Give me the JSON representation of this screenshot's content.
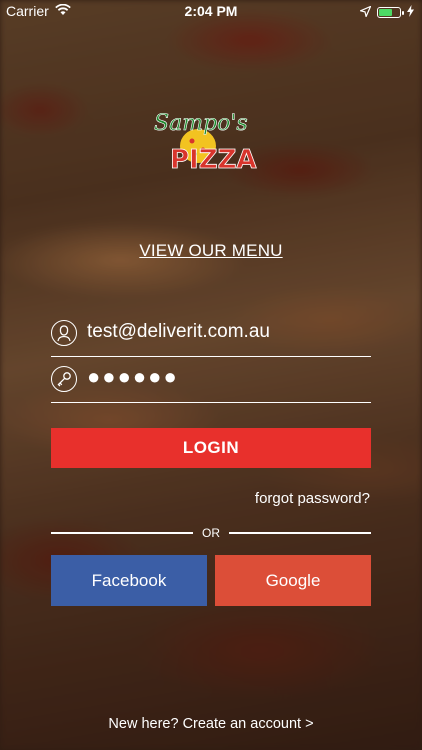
{
  "status_bar": {
    "carrier": "Carrier",
    "time": "2:04 PM"
  },
  "logo": {
    "text": "Sampo's PIZZA"
  },
  "menu_link": "VIEW OUR MENU",
  "email_field": {
    "value": "test@deliverit.com.au",
    "icon": "person-icon"
  },
  "password_field": {
    "value": "●●●●●●",
    "icon": "key-icon"
  },
  "login_button": "LOGIN",
  "forgot_password": "forgot password?",
  "divider_text": "OR",
  "facebook_button": "Facebook",
  "google_button": "Google",
  "create_account": "New here? Create an account >",
  "colors": {
    "login": "#e8302c",
    "facebook": "#3b5ea6",
    "google": "#dc4e38"
  }
}
